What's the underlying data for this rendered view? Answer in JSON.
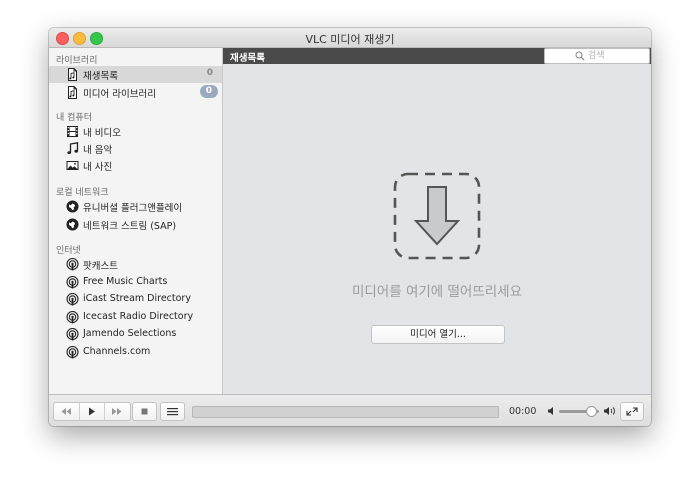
{
  "window": {
    "title": "VLC 미디어 재생기"
  },
  "sidebar": {
    "sections": [
      {
        "title": "라이브러리",
        "items": [
          {
            "label": "재생목록",
            "icon": "playlist-doc-icon",
            "count": "0",
            "selected": true
          },
          {
            "label": "미디어 라이브러리",
            "icon": "media-library-doc-icon",
            "count": "0",
            "pill": true
          }
        ]
      },
      {
        "title": "내 컴퓨터",
        "items": [
          {
            "label": "내 비디오",
            "icon": "film-icon"
          },
          {
            "label": "내 음악",
            "icon": "music-note-icon"
          },
          {
            "label": "내 사진",
            "icon": "photo-icon"
          }
        ]
      },
      {
        "title": "로컬 네트워크",
        "items": [
          {
            "label": "유니버셜 플러그앤플레이",
            "icon": "network-globe-icon"
          },
          {
            "label": "네트워크 스트림 (SAP)",
            "icon": "network-globe-icon"
          }
        ]
      },
      {
        "title": "인터넷",
        "items": [
          {
            "label": "팟캐스트",
            "icon": "podcast-icon"
          },
          {
            "label": "Free Music Charts",
            "icon": "podcast-icon"
          },
          {
            "label": "iCast Stream Directory",
            "icon": "podcast-icon"
          },
          {
            "label": "Icecast Radio Directory",
            "icon": "podcast-icon"
          },
          {
            "label": "Jamendo Selections",
            "icon": "podcast-icon"
          },
          {
            "label": "Channels.com",
            "icon": "podcast-icon"
          }
        ]
      }
    ]
  },
  "content": {
    "header": "재생목록",
    "search_placeholder": "검색",
    "drop_text": "미디어를 여기에 떨어뜨리세요",
    "open_button": "미디어 열기..."
  },
  "player": {
    "time": "00:00",
    "progress": 0,
    "volume": 0.8
  },
  "colors": {
    "selected_bg": "#d8d8d8",
    "content_bg": "#e2e4e8",
    "header_bg": "#4a4a4a",
    "pill_bg": "#9ba9c0"
  }
}
